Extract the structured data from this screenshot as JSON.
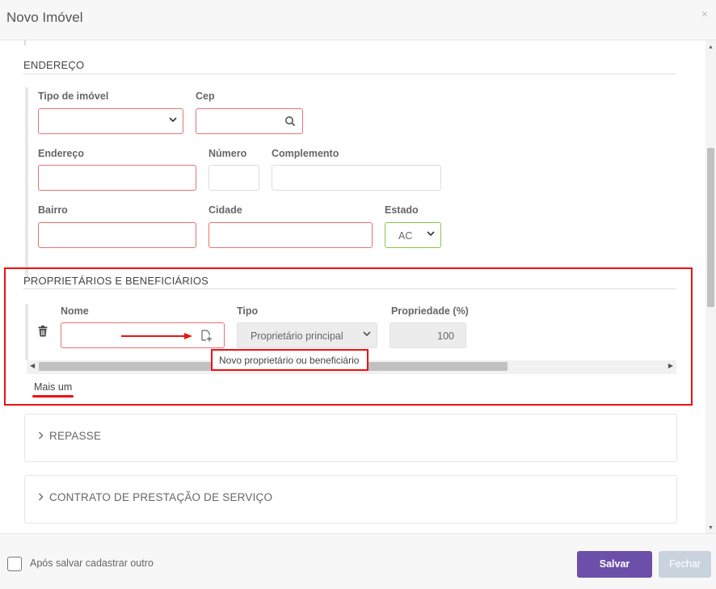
{
  "header": {
    "title": "Novo Imóvel",
    "close_symbol": "×"
  },
  "endereco": {
    "title": "ENDEREÇO",
    "tipo_imovel": {
      "label": "Tipo de imóvel",
      "value": ""
    },
    "cep": {
      "label": "Cep",
      "value": ""
    },
    "endereco": {
      "label": "Endereço",
      "value": ""
    },
    "numero": {
      "label": "Número",
      "value": ""
    },
    "complemento": {
      "label": "Complemento",
      "value": ""
    },
    "bairro": {
      "label": "Bairro",
      "value": ""
    },
    "cidade": {
      "label": "Cidade",
      "value": ""
    },
    "estado": {
      "label": "Estado",
      "value": "AC"
    }
  },
  "proprietarios": {
    "title": "PROPRIETÁRIOS E BENEFICIÁRIOS",
    "nome_label": "Nome",
    "tipo_label": "Tipo",
    "propriedade_label": "Propriedade (%)",
    "row": {
      "nome": "",
      "tipo": "Proprietário principal",
      "propriedade": "100"
    },
    "tooltip": "Novo proprietário ou beneficiário",
    "mais_um": "Mais um"
  },
  "sections": [
    {
      "label": "REPASSE"
    },
    {
      "label": "CONTRATO DE PRESTAÇÃO DE SERVIÇO"
    }
  ],
  "footer": {
    "checkbox_label": "Após salvar cadastrar outro",
    "save_label": "Salvar",
    "close_label": "Fechar"
  },
  "colors": {
    "accent": "#6c4fa8",
    "error_border": "#e57373",
    "highlight": "#ee1111"
  }
}
